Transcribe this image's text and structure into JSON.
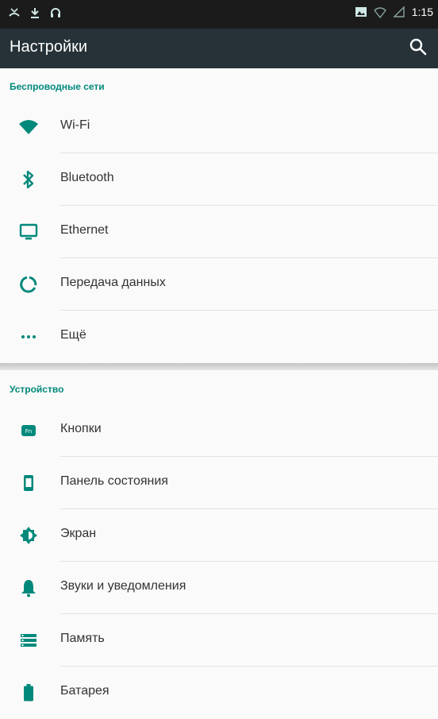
{
  "status_bar": {
    "time": "1:15",
    "left_icons": [
      "missed-call-icon",
      "download-icon",
      "headset-icon"
    ],
    "right_icons": [
      "image-icon",
      "wifi-icon",
      "signal-icon"
    ]
  },
  "app_bar": {
    "title": "Настройки",
    "search_icon": "search-icon"
  },
  "colors": {
    "accent": "#00897b",
    "app_bar": "#263238",
    "status_bar": "#1b1b1b"
  },
  "sections": [
    {
      "title": "Беспроводные сети",
      "items": [
        {
          "label": "Wi-Fi",
          "icon": "wifi-icon"
        },
        {
          "label": "Bluetooth",
          "icon": "bluetooth-icon"
        },
        {
          "label": "Ethernet",
          "icon": "monitor-icon"
        },
        {
          "label": "Передача данных",
          "icon": "data-usage-icon"
        },
        {
          "label": "Ещё",
          "icon": "more-icon"
        }
      ]
    },
    {
      "title": "Устройство",
      "items": [
        {
          "label": "Кнопки",
          "icon": "fn-key-icon"
        },
        {
          "label": "Панель состояния",
          "icon": "phone-icon"
        },
        {
          "label": "Экран",
          "icon": "brightness-icon"
        },
        {
          "label": "Звуки и уведомления",
          "icon": "bell-icon"
        },
        {
          "label": "Память",
          "icon": "storage-icon"
        },
        {
          "label": "Батарея",
          "icon": "battery-icon"
        }
      ]
    }
  ]
}
